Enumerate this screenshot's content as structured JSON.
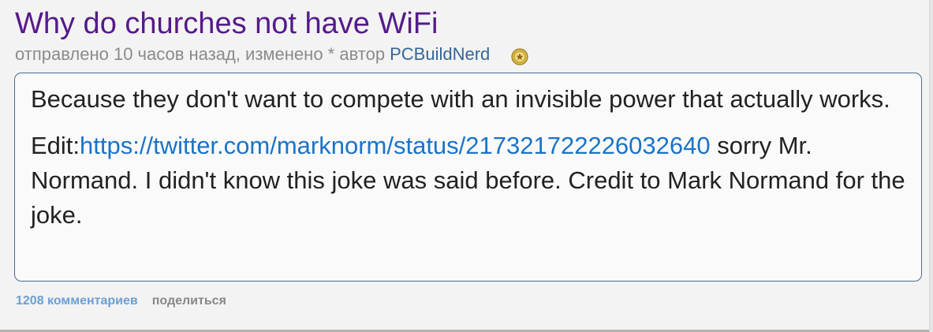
{
  "post": {
    "title": "Why do churches not have WiFi",
    "tagline": {
      "prefix": "отправлено 10 часов назад, изменено * автор",
      "author": "PCBuildNerd",
      "award_icon": "trophy-icon"
    },
    "body": {
      "paragraph1": "Because they don't want to compete with an invisible power that actually works.",
      "edit_prefix": "Edit:",
      "edit_link": "https://twitter.com/marknorm/status/217321722226032640",
      "edit_suffix": " sorry Mr. Normand. I didn't know this joke was said before. Credit to Mark Normand for the joke."
    },
    "buttons": {
      "comments": "1208 комментариев",
      "share": "поделиться"
    }
  },
  "colors": {
    "title": "#551a8b",
    "author": "#336699",
    "link": "#1a73c8",
    "border": "#4a6a96"
  }
}
